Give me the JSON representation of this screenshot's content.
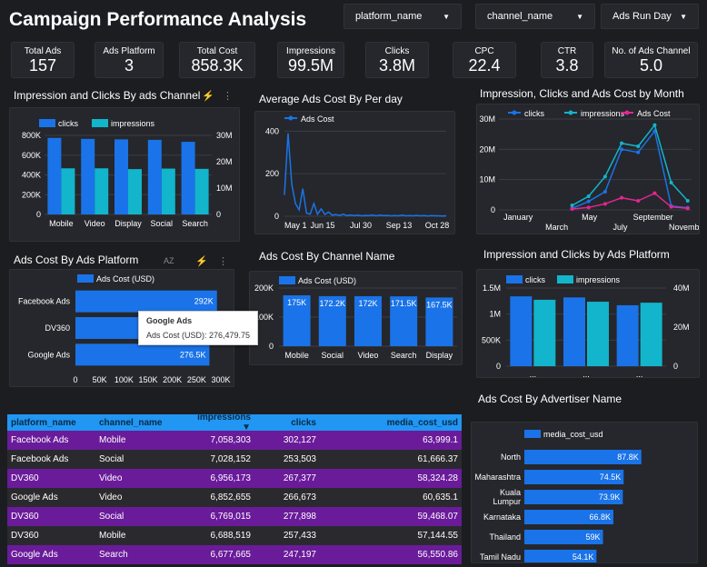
{
  "title": "Campaign Performance Analysis",
  "filters": [
    {
      "label": "platform_name"
    },
    {
      "label": "channel_name"
    },
    {
      "label": "Ads Run Day"
    }
  ],
  "kpis": [
    {
      "label": "Total Ads",
      "value": "157"
    },
    {
      "label": "Ads Platform",
      "value": "3"
    },
    {
      "label": "Total Cost",
      "value": "858.3K"
    },
    {
      "label": "Impressions",
      "value": "99.5M"
    },
    {
      "label": "Clicks",
      "value": "3.8M"
    },
    {
      "label": "CPC",
      "value": "22.4"
    },
    {
      "label": "CTR",
      "value": "3.8"
    },
    {
      "label": "No. of Ads Channel",
      "value": "5.0"
    }
  ],
  "colors": {
    "clicks": "#1a73e8",
    "impressions": "#12b5cb",
    "cost": "#e52592",
    "bg": "#1c1d21",
    "panel": "#25272c"
  },
  "icons": {
    "sort": "AZ",
    "bolt": "⚡",
    "menu": "⋮"
  },
  "chart_data": [
    {
      "type": "bar",
      "title": "Impression and Clicks By ads Channel",
      "categories": [
        "Mobile",
        "Video",
        "Display",
        "Social",
        "Search"
      ],
      "series": [
        {
          "name": "clicks",
          "values": [
            775000,
            765000,
            760000,
            755000,
            735000
          ],
          "axis": "left"
        },
        {
          "name": "impressions",
          "values": [
            17500000,
            17500000,
            17200000,
            17400000,
            17300000
          ],
          "axis": "right"
        }
      ],
      "ylim_left": [
        0,
        800000
      ],
      "yticks_left": [
        "0",
        "200K",
        "400K",
        "600K",
        "800K"
      ],
      "ylim_right": [
        0,
        30000000
      ],
      "yticks_right": [
        "0",
        "10M",
        "20M",
        "30M"
      ]
    },
    {
      "type": "line",
      "title": "Average Ads Cost By Per day",
      "series": [
        {
          "name": "Ads Cost"
        }
      ],
      "xticks": [
        "May 1",
        "Jun 15",
        "Jul 30",
        "Sep 13",
        "Oct 28"
      ],
      "yticks": [
        "0",
        "200",
        "400"
      ],
      "ylim": [
        0,
        440
      ],
      "values": [
        100,
        390,
        150,
        60,
        30,
        130,
        15,
        10,
        60,
        10,
        35,
        8,
        20,
        5,
        8,
        4,
        10,
        3,
        6,
        3,
        5,
        2,
        4,
        3,
        6,
        2,
        5,
        3,
        4,
        2,
        3,
        2,
        5,
        2,
        3,
        2,
        4,
        2,
        3,
        1,
        3,
        2,
        2,
        1,
        2
      ]
    },
    {
      "type": "line",
      "title": "Impression, Clicks and Ads Cost by Month",
      "series": [
        {
          "name": "clicks",
          "values": [
            500000,
            2800000,
            6000000,
            20000000,
            19000000,
            26000000,
            1300000,
            700000
          ]
        },
        {
          "name": "impressions",
          "values": [
            1500000,
            4500000,
            11000000,
            22000000,
            21000000,
            28000000,
            9000000,
            3000000
          ]
        },
        {
          "name": "Ads Cost",
          "values": [
            300000,
            800000,
            2000000,
            4000000,
            3000000,
            5500000,
            1000000,
            500000
          ]
        }
      ],
      "xticks_top": [
        "January",
        "May",
        "September"
      ],
      "xticks_bottom": [
        "March",
        "July",
        "November"
      ],
      "yticks": [
        "0",
        "10M",
        "20M",
        "30M"
      ],
      "ylim": [
        0,
        30000000
      ]
    },
    {
      "type": "bar",
      "orientation": "horizontal",
      "title": "Ads Cost By Ads Platform",
      "categories": [
        "Facebook Ads",
        "DV360",
        "Google Ads"
      ],
      "series": [
        {
          "name": "Ads Cost (USD)",
          "values": [
            292000,
            290000,
            276500
          ]
        }
      ],
      "data_labels": [
        "292K",
        "",
        "276.5K"
      ],
      "xticks": [
        "0",
        "50K",
        "100K",
        "150K",
        "200K",
        "250K",
        "300K"
      ],
      "xlim": [
        0,
        300000
      ]
    },
    {
      "type": "bar",
      "title": "Ads Cost By Channel Name",
      "categories": [
        "Mobile",
        "Social",
        "Video",
        "Search",
        "Display"
      ],
      "series": [
        {
          "name": "Ads Cost (USD)",
          "values": [
            175000,
            172200,
            172000,
            171500,
            167500
          ]
        }
      ],
      "data_labels": [
        "175K",
        "172.2K",
        "172K",
        "171.5K",
        "167.5K"
      ],
      "yticks": [
        "0",
        "100K",
        "200K"
      ],
      "ylim": [
        0,
        200000
      ]
    },
    {
      "type": "bar",
      "title": "Impression and Clicks by Ads Platform",
      "categories": [
        "...",
        "...",
        "..."
      ],
      "series": [
        {
          "name": "clicks",
          "values": [
            1340000,
            1320000,
            1170000
          ],
          "axis": "left"
        },
        {
          "name": "impressions",
          "values": [
            34000000,
            33000000,
            32500000
          ],
          "axis": "right"
        }
      ],
      "ylim_left": [
        0,
        1500000
      ],
      "yticks_left": [
        "0",
        "500K",
        "1M",
        "1.5M"
      ],
      "ylim_right": [
        0,
        40000000
      ],
      "yticks_right": [
        "0",
        "20M",
        "40M"
      ]
    },
    {
      "type": "bar",
      "orientation": "horizontal",
      "title": "Ads Cost By Advertiser Name",
      "categories": [
        "North",
        "Maharashtra",
        "Kuala Lumpur",
        "Karnataka",
        "Thailand",
        "Tamil Nadu"
      ],
      "series": [
        {
          "name": "media_cost_usd",
          "values": [
            87800,
            74500,
            73900,
            66800,
            59000,
            54100
          ]
        }
      ],
      "data_labels": [
        "87.8K",
        "74.5K",
        "73.9K",
        "66.8K",
        "59K",
        "54.1K"
      ],
      "xlim": [
        0,
        90000
      ]
    }
  ],
  "tooltip": {
    "title": "Google Ads",
    "label": "Ads Cost (USD): 276,479.75"
  },
  "table": {
    "headers": [
      "platform_name",
      "channel_name",
      "impressions ▼",
      "clicks",
      "media_cost_usd"
    ],
    "rows": [
      [
        "Facebook Ads",
        "Mobile",
        "7,058,303",
        "302,127",
        "63,999.1"
      ],
      [
        "Facebook Ads",
        "Social",
        "7,028,152",
        "253,503",
        "61,666.37"
      ],
      [
        "DV360",
        "Video",
        "6,956,173",
        "267,377",
        "58,324.28"
      ],
      [
        "Google Ads",
        "Video",
        "6,852,655",
        "266,673",
        "60,635.1"
      ],
      [
        "DV360",
        "Social",
        "6,769,015",
        "277,898",
        "59,468.07"
      ],
      [
        "DV360",
        "Mobile",
        "6,688,519",
        "257,433",
        "57,144.55"
      ],
      [
        "Google Ads",
        "Search",
        "6,677,665",
        "247,197",
        "56,550.86"
      ]
    ]
  }
}
